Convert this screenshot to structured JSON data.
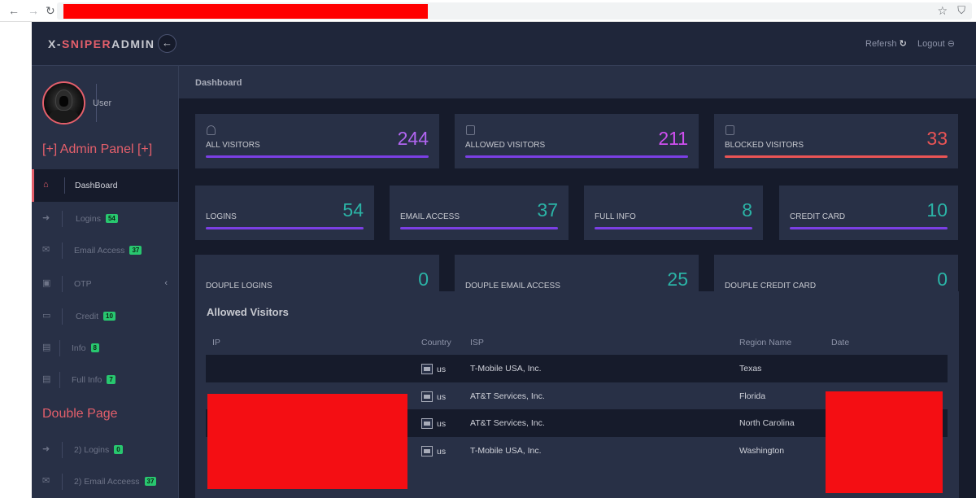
{
  "browser": {
    "back": "←",
    "forward": "→",
    "reload": "↻",
    "star": "☆",
    "shield": "⛉"
  },
  "app": {
    "brand": {
      "part1": "X-",
      "accent": "SNIPER",
      "part2": "ADMIN"
    },
    "back_button": "←",
    "refresh_label": "Refersh",
    "refresh_icon": "↻",
    "logout_label": "Logout",
    "logout_icon": "⊖"
  },
  "sidebar": {
    "user_name": "User",
    "panel_title": "[+] Admin Panel [+]",
    "items": [
      {
        "label": "DashBoard",
        "icon": "⌂",
        "badge": ""
      },
      {
        "label": "Logins",
        "icon": "➜",
        "badge": "54"
      },
      {
        "label": "Email Access",
        "icon": "✉",
        "badge": "37"
      },
      {
        "label": "OTP",
        "icon": "▣",
        "badge": ""
      },
      {
        "label": "Credit",
        "icon": "▭",
        "badge": "10"
      },
      {
        "label": "Info",
        "icon": "▤",
        "badge": "8"
      },
      {
        "label": "Full Info",
        "icon": "▤",
        "badge": "7"
      }
    ],
    "otp_chevron": "‹",
    "double_title": "Double Page",
    "double_items": [
      {
        "label": "2) Logins",
        "icon": "➜",
        "badge": "0"
      },
      {
        "label": "2) Email Acceess",
        "icon": "✉",
        "badge": "37"
      }
    ]
  },
  "breadcrumb": "Dashboard",
  "cards": [
    {
      "label": "ALL VISITORS",
      "value": "244",
      "color": "#b165f0"
    },
    {
      "label": "ALLOWED VISITORS",
      "value": "211",
      "color": "#cf4ff0"
    },
    {
      "label": "BLOCKED VISITORS",
      "value": "33",
      "color": "#ea5455"
    },
    {
      "label": "LOGINS",
      "value": "54",
      "color": "#2bb3a6"
    },
    {
      "label": "EMAIL ACCESS",
      "value": "37",
      "color": "#2bb3a6"
    },
    {
      "label": "FULL INFO",
      "value": "8",
      "color": "#2bb3a6"
    },
    {
      "label": "CREDIT CARD",
      "value": "10",
      "color": "#2bb3a6"
    },
    {
      "label": "DOUPLE LOGINS",
      "value": "0",
      "color": "#2bb3a6"
    },
    {
      "label": "DOUPLE EMAIL ACCESS",
      "value": "25",
      "color": "#2bb3a6"
    },
    {
      "label": "DOUPLE CREDIT CARD",
      "value": "0",
      "color": "#2bb3a6"
    }
  ],
  "bar_colors": {
    "purple": "#7b3fe4",
    "red": "#ea5455"
  },
  "table": {
    "title": "Allowed Visitors",
    "columns": [
      "IP",
      "Country",
      "ISP",
      "Region Name",
      "Date"
    ],
    "rows": [
      {
        "country": "us",
        "isp": "T-Mobile USA, Inc.",
        "region": "Texas"
      },
      {
        "country": "us",
        "isp": "AT&T Services, Inc.",
        "region": "Florida"
      },
      {
        "country": "us",
        "isp": "AT&T Services, Inc.",
        "region": "North Carolina"
      },
      {
        "country": "us",
        "isp": "T-Mobile USA, Inc.",
        "region": "Washington"
      }
    ]
  }
}
